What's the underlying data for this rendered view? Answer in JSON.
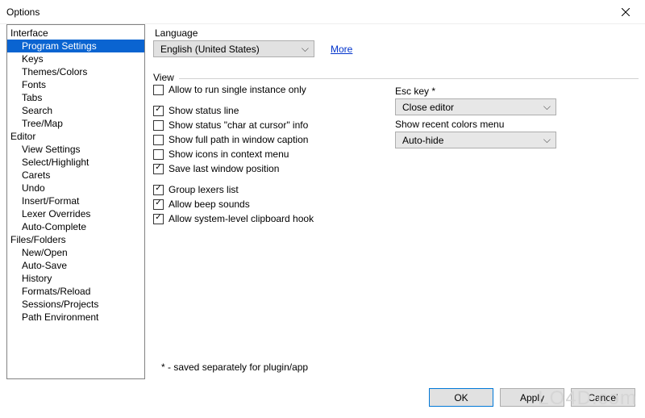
{
  "window": {
    "title": "Options"
  },
  "tree": {
    "items": [
      {
        "label": "Interface",
        "level": 0
      },
      {
        "label": "Program Settings",
        "level": 1,
        "selected": true
      },
      {
        "label": "Keys",
        "level": 1
      },
      {
        "label": "Themes/Colors",
        "level": 1
      },
      {
        "label": "Fonts",
        "level": 1
      },
      {
        "label": "Tabs",
        "level": 1
      },
      {
        "label": "Search",
        "level": 1
      },
      {
        "label": "Tree/Map",
        "level": 1
      },
      {
        "label": "Editor",
        "level": 0
      },
      {
        "label": "View Settings",
        "level": 1
      },
      {
        "label": "Select/Highlight",
        "level": 1
      },
      {
        "label": "Carets",
        "level": 1
      },
      {
        "label": "Undo",
        "level": 1
      },
      {
        "label": "Insert/Format",
        "level": 1
      },
      {
        "label": "Lexer Overrides",
        "level": 1
      },
      {
        "label": "Auto-Complete",
        "level": 1
      },
      {
        "label": "Files/Folders",
        "level": 0
      },
      {
        "label": "New/Open",
        "level": 1
      },
      {
        "label": "Auto-Save",
        "level": 1
      },
      {
        "label": "History",
        "level": 1
      },
      {
        "label": "Formats/Reload",
        "level": 1
      },
      {
        "label": "Sessions/Projects",
        "level": 1
      },
      {
        "label": "Path Environment",
        "level": 1
      }
    ]
  },
  "lang": {
    "label": "Language",
    "value": "English (United States)",
    "more": "More"
  },
  "view": {
    "label": "View",
    "checks": [
      {
        "label": "Allow to run single instance only",
        "checked": false
      },
      {
        "gap": true
      },
      {
        "label": "Show status line",
        "checked": true
      },
      {
        "label": "Show status \"char at cursor\" info",
        "checked": false
      },
      {
        "label": "Show full path in window caption",
        "checked": false
      },
      {
        "label": "Show icons in context menu",
        "checked": false
      },
      {
        "label": "Save last window position",
        "checked": true
      },
      {
        "gap": true
      },
      {
        "label": "Group lexers list",
        "checked": true
      },
      {
        "label": "Allow beep sounds",
        "checked": true
      },
      {
        "label": "Allow system-level clipboard hook",
        "checked": true
      }
    ],
    "esc": {
      "label": "Esc key *",
      "value": "Close editor"
    },
    "recent": {
      "label": "Show recent colors menu",
      "value": "Auto-hide"
    }
  },
  "footnote": "* - saved separately for plugin/app",
  "buttons": {
    "ok": "OK",
    "apply": "Apply",
    "cancel": "Cancel"
  },
  "watermark": "LO4D.com"
}
